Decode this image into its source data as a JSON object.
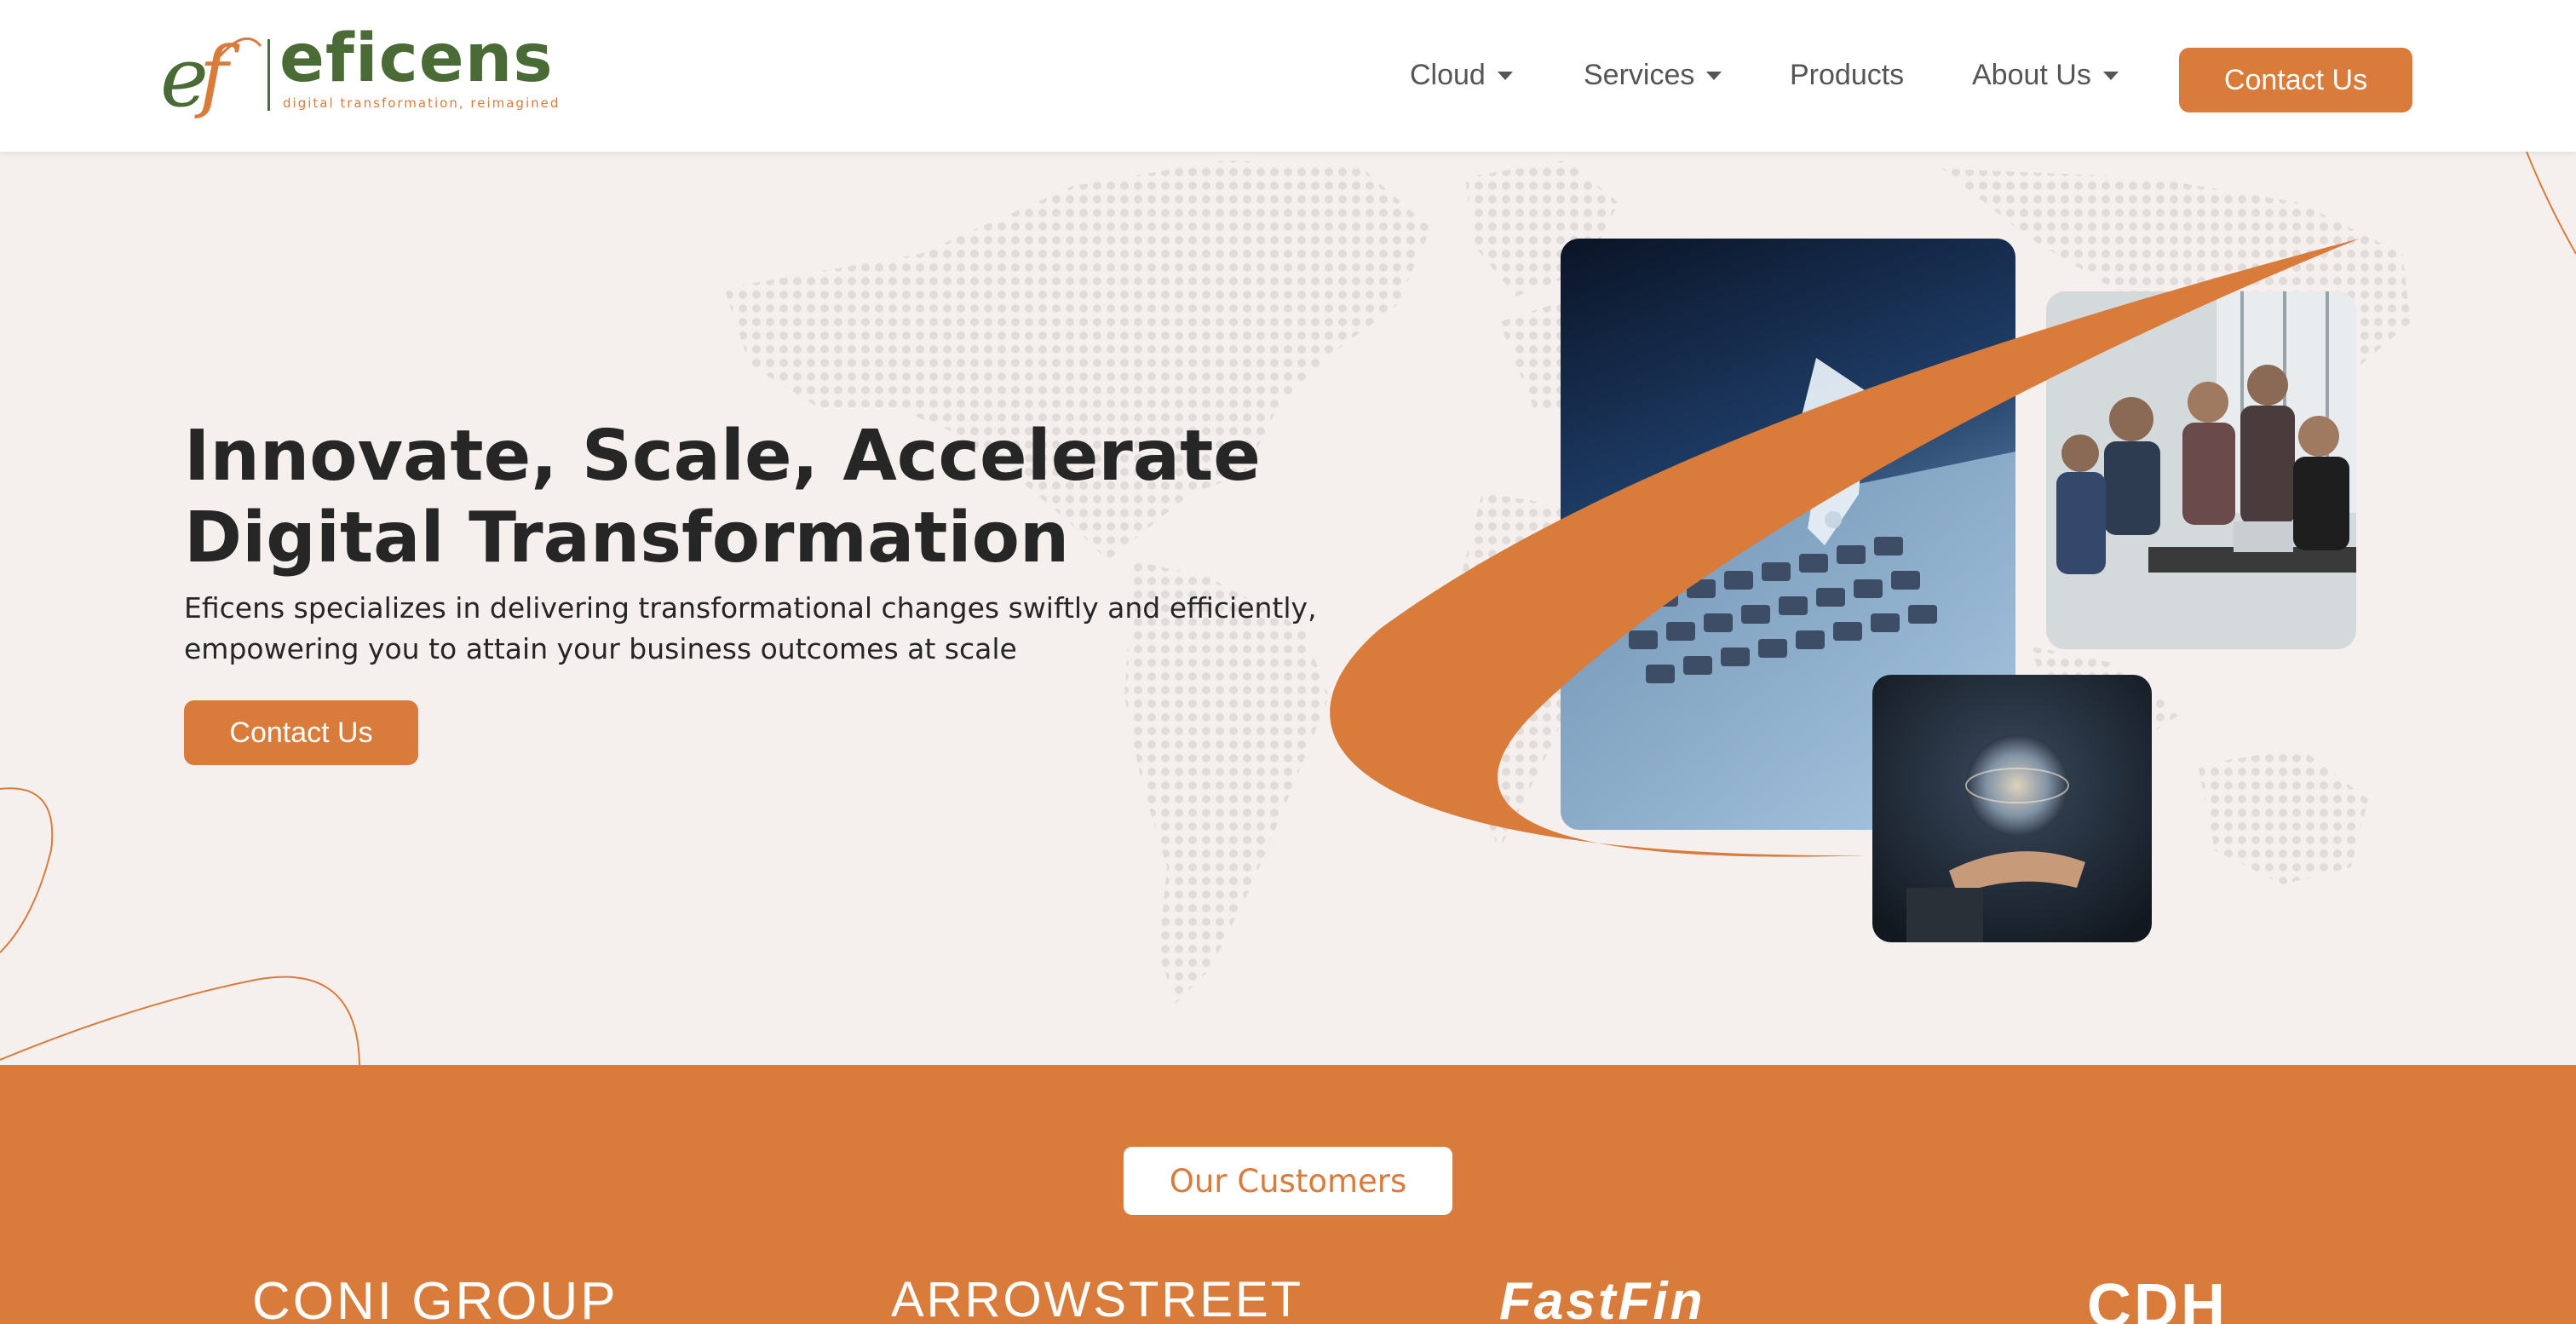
{
  "brand": {
    "name": "eficens",
    "mark": "ef",
    "tagline": "digital transformation, reimagined"
  },
  "nav": {
    "items": [
      {
        "label": "Cloud",
        "dropdown": true
      },
      {
        "label": "Services",
        "dropdown": true
      },
      {
        "label": "Products",
        "dropdown": false
      },
      {
        "label": "About Us",
        "dropdown": true
      }
    ],
    "cta": "Contact Us"
  },
  "hero": {
    "title_line1": "Innovate, Scale, Accelerate",
    "title_line2": "Digital Transformation",
    "description_line1": "Eficens specializes in delivering transformational changes swiftly and efficiently,",
    "description_line2": "empowering you to attain your business outcomes at scale",
    "cta": "Contact Us"
  },
  "customers": {
    "heading": "Our Customers",
    "logos": [
      "CONI GROUP",
      "ARROWSTREET",
      "FastFin",
      "CDH"
    ]
  },
  "colors": {
    "accent": "#d97b3a",
    "brand_green": "#4a6b35",
    "hero_bg": "#f5f0ee",
    "text_dark": "#262626",
    "nav_text": "#555555"
  },
  "icons": {
    "dropdown": "caret-down-icon"
  }
}
